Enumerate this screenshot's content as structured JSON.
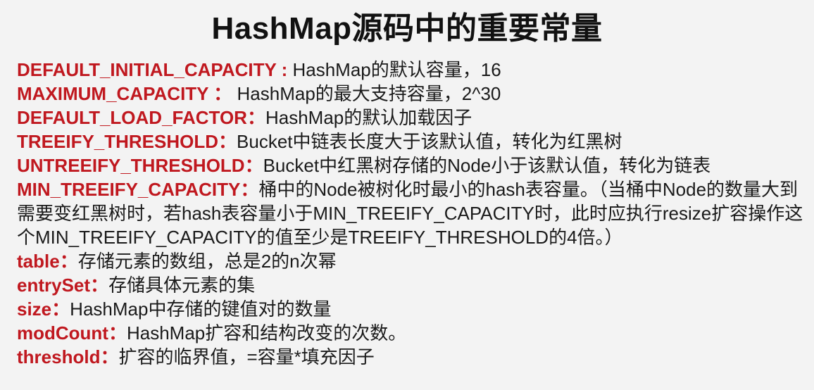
{
  "title": "HashMap源码中的重要常量",
  "items": [
    {
      "key": "DEFAULT_INITIAL_CAPACITY",
      "sep": " : ",
      "desc": "HashMap的默认容量，16"
    },
    {
      "key": "MAXIMUM_CAPACITY",
      "sep": " ： ",
      "desc": "HashMap的最大支持容量，2^30"
    },
    {
      "key": "DEFAULT_LOAD_FACTOR",
      "sep": "：",
      "desc": "HashMap的默认加载因子"
    },
    {
      "key": "TREEIFY_THRESHOLD",
      "sep": "：",
      "desc": "Bucket中链表长度大于该默认值，转化为红黑树"
    },
    {
      "key": "UNTREEIFY_THRESHOLD",
      "sep": "：",
      "desc": "Bucket中红黑树存储的Node小于该默认值，转化为链表"
    },
    {
      "key": "MIN_TREEIFY_CAPACITY",
      "sep": "：",
      "desc": "桶中的Node被树化时最小的hash表容量。（当桶中Node的数量大到需要变红黑树时，若hash表容量小于MIN_TREEIFY_CAPACITY时，此时应执行resize扩容操作这个MIN_TREEIFY_CAPACITY的值至少是TREEIFY_THRESHOLD的4倍。）"
    },
    {
      "key": "table",
      "sep": "：",
      "desc": "存储元素的数组，总是2的n次幂"
    },
    {
      "key": "entrySet",
      "sep": "：",
      "desc": "存储具体元素的集"
    },
    {
      "key": "size",
      "sep": "：",
      "desc": "HashMap中存储的键值对的数量"
    },
    {
      "key": "modCount",
      "sep": "：",
      "desc": "HashMap扩容和结构改变的次数。"
    },
    {
      "key": "threshold",
      "sep": "：",
      "desc": "扩容的临界值，=容量*填充因子"
    }
  ]
}
